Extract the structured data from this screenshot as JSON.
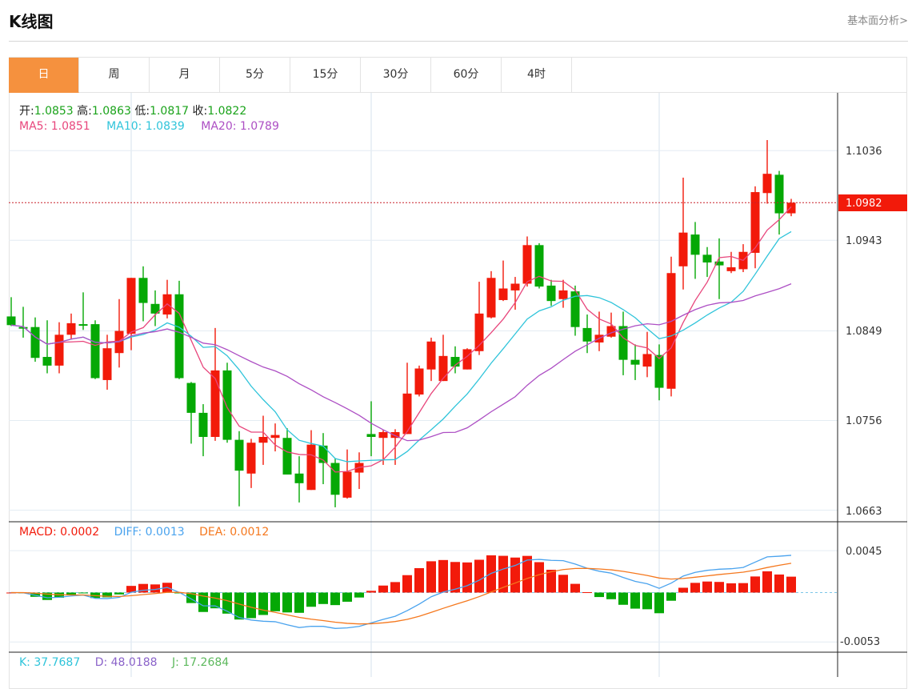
{
  "header": {
    "title": "K线图",
    "fundamental_link": "基本面分析>"
  },
  "tabs": [
    {
      "label": "日",
      "active": true
    },
    {
      "label": "周"
    },
    {
      "label": "月"
    },
    {
      "label": "5分"
    },
    {
      "label": "15分"
    },
    {
      "label": "30分"
    },
    {
      "label": "60分"
    },
    {
      "label": "4时"
    }
  ],
  "ohlc_info": {
    "open_label": "开:",
    "open": "1.0853",
    "high_label": "高:",
    "high": "1.0863",
    "low_label": "低:",
    "low": "1.0817",
    "close_label": "收:",
    "close": "1.0822"
  },
  "ma_info": {
    "ma5": "MA5: 1.0851",
    "ma10": "MA10: 1.0839",
    "ma20": "MA20: 1.0789"
  },
  "macd_info": {
    "macd": "MACD: 0.0002",
    "diff": "DIFF: 0.0013",
    "dea": "DEA: 0.0012"
  },
  "kdj_info": {
    "k": "K: 37.7687",
    "d": "D: 48.0188",
    "j": "J: 17.2684"
  },
  "colors": {
    "up": "#f21a0a",
    "down": "#05a805",
    "ma5": "#e8467c",
    "ma10": "#2fc4da",
    "ma20": "#ad4fc4",
    "diff": "#4aa3ee",
    "dea": "#f5781e",
    "accent": "#f5913e"
  },
  "chart_data": {
    "type": "candlestick",
    "price_axis": {
      "ticks": [
        "1.1036",
        "1.0943",
        "1.0849",
        "1.0756",
        "1.0663"
      ],
      "ylim": [
        1.0651,
        1.1096
      ]
    },
    "current_price": "1.0982",
    "macd_axis": {
      "ticks": [
        "0.0045",
        "-0.0053"
      ],
      "ylim": [
        -0.0064,
        0.0076
      ]
    },
    "ma_periods": [
      5,
      10,
      20
    ],
    "candles_ohlc": [
      [
        1.0864,
        1.0884,
        1.0854,
        1.0855
      ],
      [
        1.0853,
        1.0874,
        1.0842,
        1.0852
      ],
      [
        1.0853,
        1.0863,
        1.0817,
        1.0821
      ],
      [
        1.0822,
        1.086,
        1.0805,
        1.0813
      ],
      [
        1.0813,
        1.0858,
        1.0805,
        1.0845
      ],
      [
        1.0845,
        1.0867,
        1.084,
        1.0857
      ],
      [
        1.0856,
        1.0889,
        1.085,
        1.0855
      ],
      [
        1.0856,
        1.086,
        1.0799,
        1.08
      ],
      [
        1.0798,
        1.0845,
        1.0788,
        1.0831
      ],
      [
        1.0826,
        1.0882,
        1.0811,
        1.0849
      ],
      [
        1.0846,
        1.0904,
        1.0829,
        1.0904
      ],
      [
        1.0904,
        1.0916,
        1.0859,
        1.0878
      ],
      [
        1.0877,
        1.0891,
        1.0854,
        1.0867
      ],
      [
        1.0866,
        1.0902,
        1.0862,
        1.0887
      ],
      [
        1.0887,
        1.0901,
        1.0799,
        1.08
      ],
      [
        1.0795,
        1.0796,
        1.0732,
        1.0764
      ],
      [
        1.0764,
        1.0773,
        1.0719,
        1.0739
      ],
      [
        1.0739,
        1.0852,
        1.0735,
        1.0808
      ],
      [
        1.0808,
        1.0816,
        1.0733,
        1.0736
      ],
      [
        1.0736,
        1.0745,
        1.0667,
        1.0704
      ],
      [
        1.0701,
        1.0737,
        1.0686,
        1.0733
      ],
      [
        1.0733,
        1.0761,
        1.071,
        1.0739
      ],
      [
        1.0738,
        1.0753,
        1.0724,
        1.0741
      ],
      [
        1.0738,
        1.0748,
        1.07,
        1.07
      ],
      [
        1.0701,
        1.0719,
        1.0671,
        1.0691
      ],
      [
        1.0684,
        1.0746,
        1.0684,
        1.0731
      ],
      [
        1.073,
        1.0743,
        1.069,
        1.0712
      ],
      [
        1.0712,
        1.0717,
        1.0666,
        1.0679
      ],
      [
        1.0676,
        1.0726,
        1.0675,
        1.0703
      ],
      [
        1.0702,
        1.0723,
        1.0685,
        1.0712
      ],
      [
        1.0742,
        1.0776,
        1.0719,
        1.0739
      ],
      [
        1.0738,
        1.0746,
        1.071,
        1.0744
      ],
      [
        1.0738,
        1.0747,
        1.071,
        1.0744
      ],
      [
        1.0742,
        1.0816,
        1.0742,
        1.0784
      ],
      [
        1.0783,
        1.0813,
        1.0781,
        1.081
      ],
      [
        1.0809,
        1.0842,
        1.0797,
        1.0838
      ],
      [
        1.0797,
        1.0845,
        1.0797,
        1.0823
      ],
      [
        1.0822,
        1.0833,
        1.0805,
        1.0812
      ],
      [
        1.0809,
        1.0831,
        1.0809,
        1.083
      ],
      [
        1.0828,
        1.09,
        1.0824,
        1.0867
      ],
      [
        1.0863,
        1.0911,
        1.0862,
        1.0904
      ],
      [
        1.0881,
        1.0922,
        1.088,
        1.0893
      ],
      [
        1.0891,
        1.0905,
        1.0871,
        1.0898
      ],
      [
        1.0898,
        1.0947,
        1.0895,
        1.0938
      ],
      [
        1.0938,
        1.094,
        1.0893,
        1.0895
      ],
      [
        1.0896,
        1.0902,
        1.0875,
        1.088
      ],
      [
        1.0882,
        1.0902,
        1.0873,
        1.0891
      ],
      [
        1.089,
        1.0896,
        1.0844,
        1.0853
      ],
      [
        1.0852,
        1.0866,
        1.0826,
        1.0838
      ],
      [
        1.0837,
        1.0869,
        1.0828,
        1.0845
      ],
      [
        1.0843,
        1.0868,
        1.0842,
        1.0854
      ],
      [
        1.0854,
        1.0869,
        1.0803,
        1.0819
      ],
      [
        1.0819,
        1.0835,
        1.0798,
        1.0814
      ],
      [
        1.0812,
        1.0848,
        1.0801,
        1.0825
      ],
      [
        1.0824,
        1.0835,
        1.0777,
        1.079
      ],
      [
        1.0789,
        1.0926,
        1.0781,
        1.0909
      ],
      [
        1.0916,
        1.1008,
        1.0892,
        1.0951
      ],
      [
        1.0949,
        1.0962,
        1.0903,
        1.0928
      ],
      [
        1.0928,
        1.0936,
        1.0905,
        1.092
      ],
      [
        1.0921,
        1.0945,
        1.0882,
        1.0917
      ],
      [
        1.0911,
        1.0931,
        1.0909,
        1.0915
      ],
      [
        1.0913,
        1.0939,
        1.091,
        1.0931
      ],
      [
        1.093,
        1.0999,
        1.0914,
        1.0993
      ],
      [
        1.0992,
        1.1047,
        1.0981,
        1.1012
      ],
      [
        1.1011,
        1.1015,
        1.0949,
        1.0971
      ],
      [
        1.0971,
        1.0986,
        1.0968,
        1.0982
      ]
    ]
  }
}
